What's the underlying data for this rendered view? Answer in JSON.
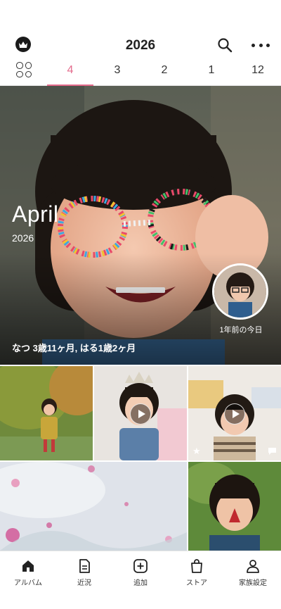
{
  "header": {
    "title": "2026"
  },
  "tabs": [
    {
      "label": "4",
      "active": true
    },
    {
      "label": "3",
      "active": false
    },
    {
      "label": "2",
      "active": false
    },
    {
      "label": "1",
      "active": false
    },
    {
      "label": "12",
      "active": false
    }
  ],
  "hero": {
    "month": "April",
    "year": "2026",
    "caption": "なつ 3歳11ヶ月, はる1歳2ヶ月",
    "memory_label": "1年前の今日"
  },
  "nav": [
    {
      "label": "アルバム",
      "icon": "home-icon"
    },
    {
      "label": "近況",
      "icon": "document-icon"
    },
    {
      "label": "追加",
      "icon": "add-icon"
    },
    {
      "label": "ストア",
      "icon": "shopping-bag-icon"
    },
    {
      "label": "家族設定",
      "icon": "person-icon"
    }
  ],
  "colors": {
    "accent": "#e46b8c",
    "text": "#222222"
  }
}
